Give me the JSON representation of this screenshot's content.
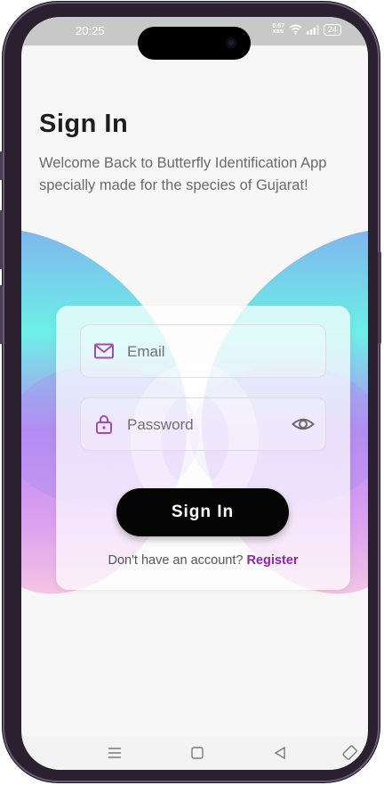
{
  "status_bar": {
    "time": "20:25",
    "net_speed_value": "0.67",
    "net_speed_unit": "KB/S",
    "battery": "24",
    "icons": [
      "wifi-icon",
      "signal-icon",
      "battery-icon"
    ]
  },
  "header": {
    "title": "Sign In",
    "subtitle": "Welcome Back to Butterfly Identification App specially made for the species of Gujarat!"
  },
  "form": {
    "email": {
      "placeholder": "Email",
      "value": "",
      "icon": "mail-icon"
    },
    "password": {
      "placeholder": "Password",
      "value": "",
      "icon": "lock-icon",
      "toggle_icon": "eye-icon"
    },
    "submit_label": "Sign In",
    "register_prompt": "Don't have an account?",
    "register_link": "Register"
  },
  "nav_bar": {
    "items": [
      "menu-icon",
      "home-square-icon",
      "back-triangle-icon",
      "rotate-icon"
    ]
  },
  "colors": {
    "accent": "#8a2aa0",
    "button": "#050505",
    "wing_blue": "#78c8ee",
    "wing_cyan": "#6cf0e6",
    "wing_purple": "#b87cf0",
    "wing_pink": "#f0b0e0"
  }
}
